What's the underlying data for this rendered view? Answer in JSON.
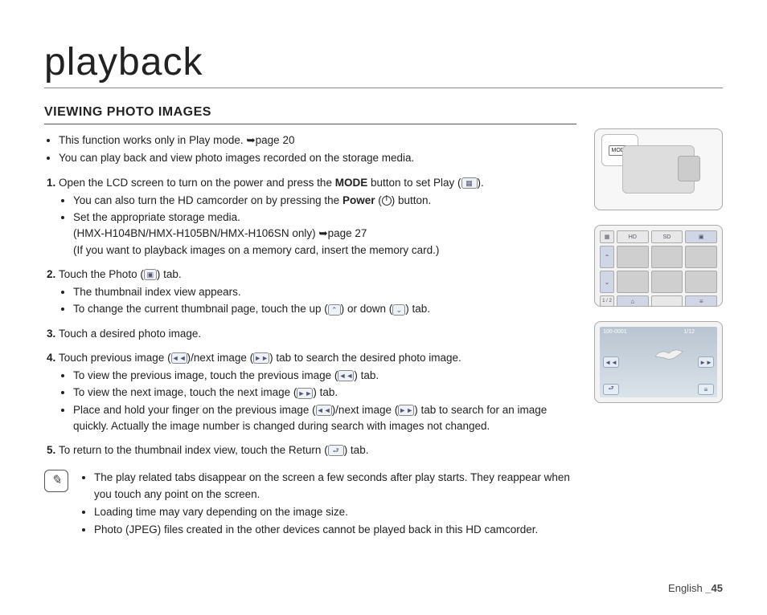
{
  "page_title": "playback",
  "section_heading": "VIEWING PHOTO IMAGES",
  "intro_bullets": [
    "This function works only in Play mode. ➥page 20",
    "You can play back and view photo images recorded on the storage media."
  ],
  "steps": [
    {
      "text_pre": "Open the LCD screen to turn on the power and press the ",
      "bold1": "MODE",
      "text_mid1": " button to set Play (",
      "icon1": "play-mode-icon",
      "text_post": ").",
      "subs": [
        {
          "pre": "You can also turn the HD camcorder on by pressing the ",
          "bold": "Power",
          "mid": " (",
          "icon": "power-icon",
          "post": ") button."
        },
        {
          "pre": "Set the appropriate storage media.",
          "line2": "(HMX-H104BN/HMX-H105BN/HMX-H106SN only) ➥page 27",
          "line3": "(If you want to playback images on a memory card, insert the memory card.)"
        }
      ]
    },
    {
      "text_pre": "Touch the Photo (",
      "icon1": "photo-tab-icon",
      "text_post": ") tab.",
      "subs": [
        {
          "pre": "The thumbnail index view appears."
        },
        {
          "pre": "To change the current thumbnail page, touch the up (",
          "icon": "up-icon",
          "mid": ") or down (",
          "icon2": "down-icon",
          "post": ") tab."
        }
      ]
    },
    {
      "text_pre": "Touch a desired photo image."
    },
    {
      "text_pre": "Touch previous image (",
      "icon1": "prev-icon",
      "text_mid1": ")/next image (",
      "icon2": "next-icon",
      "text_post": ") tab to search the desired photo image.",
      "subs": [
        {
          "pre": "To view the previous image, touch the previous image (",
          "icon": "prev-icon",
          "post": ") tab."
        },
        {
          "pre": "To view the next image, touch the next image (",
          "icon": "next-icon",
          "post": ") tab."
        },
        {
          "pre": "Place and hold your finger on the previous image (",
          "icon": "prev-icon",
          "mid": ")/next image (",
          "icon2": "next-icon",
          "post": ") tab to search for an image quickly. Actually the image number is changed during search with images not changed."
        }
      ]
    },
    {
      "text_pre": "To return to the thumbnail index view, touch the Return (",
      "icon1": "return-icon",
      "text_post": ") tab."
    }
  ],
  "notes": [
    "The play related tabs disappear on the screen a few seconds after play starts. They reappear when you touch any point on the screen.",
    "Loading time may vary depending on the image size.",
    "Photo (JPEG) files created in the other devices cannot be played back in this HD camcorder."
  ],
  "sidebar": {
    "mode_label": "MODE",
    "thumb": {
      "hd": "HD",
      "sd": "SD",
      "page_indicator": "1 / 2"
    },
    "photo": {
      "counter": "1/12",
      "filename": "100-0001"
    }
  },
  "footer": {
    "lang": "English ",
    "page": "_45"
  }
}
